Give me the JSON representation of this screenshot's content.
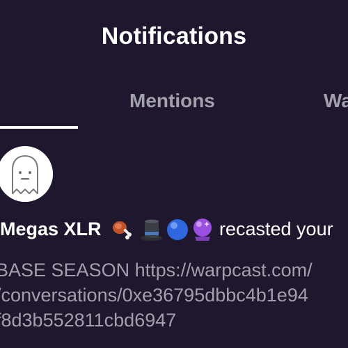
{
  "header": {
    "title": "Notifications"
  },
  "tabs": [
    {
      "label": "",
      "active": true
    },
    {
      "label": "Mentions",
      "active": false
    },
    {
      "label": "Wa",
      "active": false
    }
  ],
  "notification": {
    "avatar_icon": "ghost-icon",
    "username": "Megas XLR",
    "emojis": [
      "meat-on-bone-icon",
      "top-hat-icon",
      "blue-circle-icon",
      "crystal-ball-icon"
    ],
    "action": "recasted your",
    "text_lines": [
      "BASE SEASON https://warpcast.com/",
      "/conversations/0xe36795dbbc4b1e94",
      "f8d3b552811cbd6947"
    ]
  },
  "colors": {
    "background": "#1e172d",
    "primary_text": "#ffffff",
    "secondary_text": "#a3a0ad"
  }
}
